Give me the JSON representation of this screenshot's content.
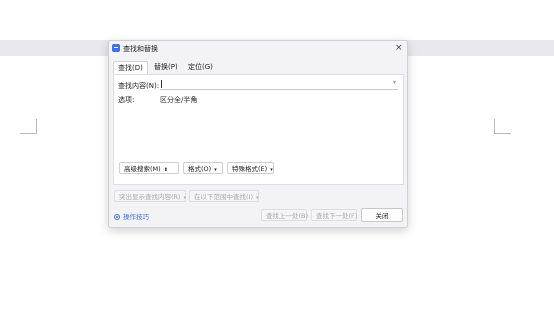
{
  "dialog": {
    "title": "查找和替换",
    "close_glyph": "×",
    "tabs": [
      {
        "label": "查找(D)",
        "active": true
      },
      {
        "label": "替换(P)",
        "active": false
      },
      {
        "label": "定位(G)",
        "active": false
      }
    ],
    "find_label": "查找内容(N):",
    "find_value": "",
    "options_label": "选项:",
    "options_value": "区分全/半角",
    "buttons": {
      "advanced_search": "高级搜索(M)",
      "advanced_search_arrow": "⬍",
      "format": "格式(O)",
      "special_format": "特殊格式(E)",
      "dropdown_arrow": "▾",
      "highlight": "突出显示查找内容(R)",
      "find_in": "在以下范围中查找(I)",
      "find_prev": "查找上一处(B)",
      "find_next": "查找下一处(F)",
      "close": "关闭"
    },
    "help_link": "操作技巧",
    "accent_color": "#3d6ff2"
  },
  "icons": [
    "app-icon",
    "close-icon",
    "chevron-down-icon",
    "help-icon"
  ]
}
